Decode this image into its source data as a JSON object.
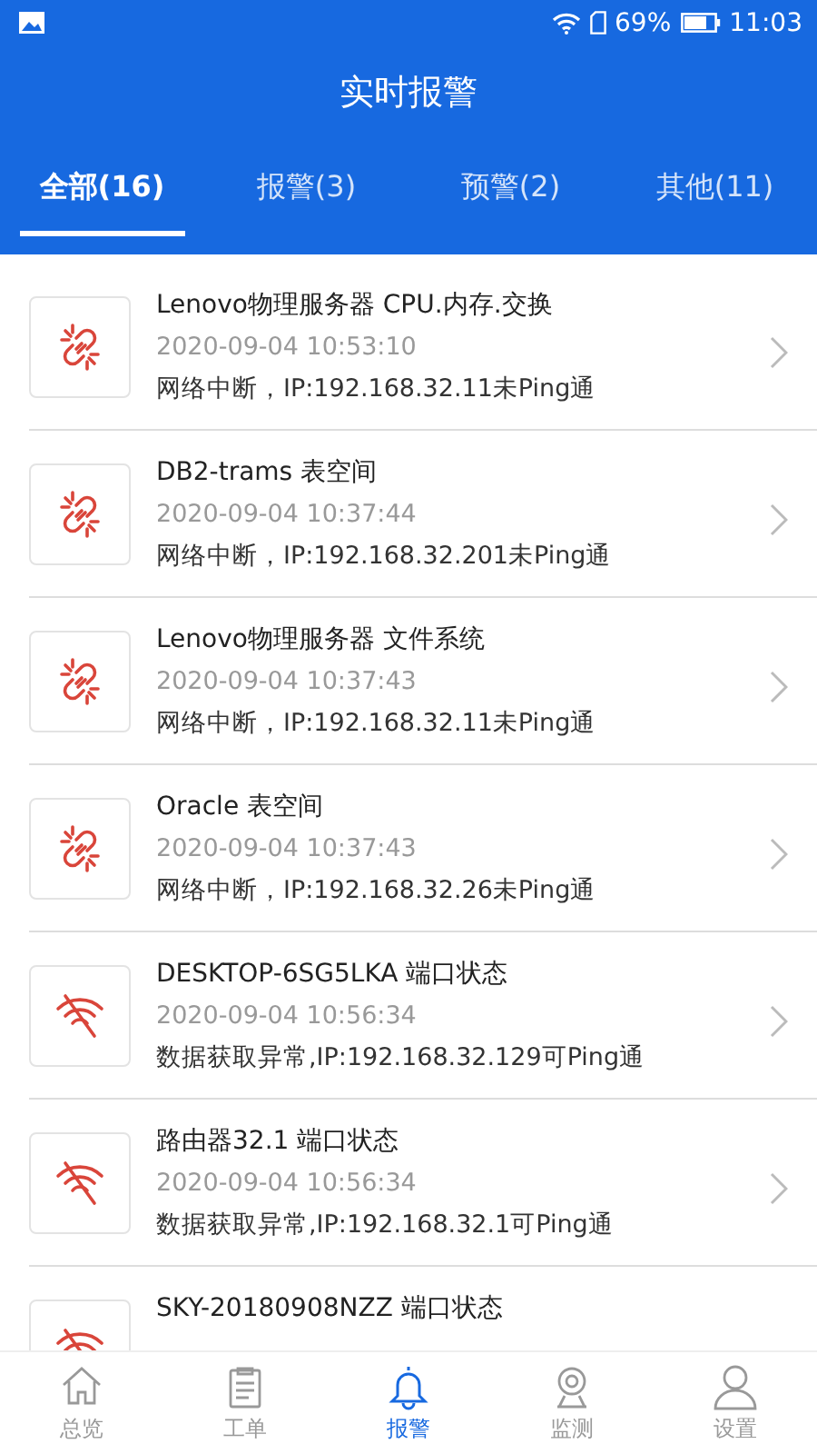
{
  "status_bar": {
    "battery": "69%",
    "time": "11:03"
  },
  "title": "实时报警",
  "tabs": [
    {
      "label": "全部(16)",
      "selected": true
    },
    {
      "label": "报警(3)",
      "selected": false
    },
    {
      "label": "预警(2)",
      "selected": false
    },
    {
      "label": "其他(11)",
      "selected": false
    }
  ],
  "alerts": [
    {
      "kind": "link_broken",
      "title": "Lenovo物理服务器 CPU.内存.交换",
      "time": "2020-09-04 10:53:10",
      "message": "网络中断，IP:192.168.32.11未Ping通"
    },
    {
      "kind": "link_broken",
      "title": "DB2-trams 表空间",
      "time": "2020-09-04 10:37:44",
      "message": "网络中断，IP:192.168.32.201未Ping通"
    },
    {
      "kind": "link_broken",
      "title": "Lenovo物理服务器 文件系统",
      "time": "2020-09-04 10:37:43",
      "message": "网络中断，IP:192.168.32.11未Ping通"
    },
    {
      "kind": "link_broken",
      "title": "Oracle 表空间",
      "time": "2020-09-04 10:37:43",
      "message": "网络中断，IP:192.168.32.26未Ping通"
    },
    {
      "kind": "wifi_off",
      "title": "DESKTOP-6SG5LKA 端口状态",
      "time": "2020-09-04 10:56:34",
      "message": "数据获取异常,IP:192.168.32.129可Ping通"
    },
    {
      "kind": "wifi_off",
      "title": "路由器32.1 端口状态",
      "time": "2020-09-04 10:56:34",
      "message": "数据获取异常,IP:192.168.32.1可Ping通"
    },
    {
      "kind": "wifi_off",
      "title": "SKY-20180908NZZ 端口状态"
    }
  ],
  "nav": [
    {
      "kind": "home",
      "label": "总览",
      "selected": false
    },
    {
      "kind": "clipboard",
      "label": "工单",
      "selected": false
    },
    {
      "kind": "bell",
      "label": "报警",
      "selected": true
    },
    {
      "kind": "camera",
      "label": "监测",
      "selected": false
    },
    {
      "kind": "person",
      "label": "设置",
      "selected": false
    }
  ]
}
